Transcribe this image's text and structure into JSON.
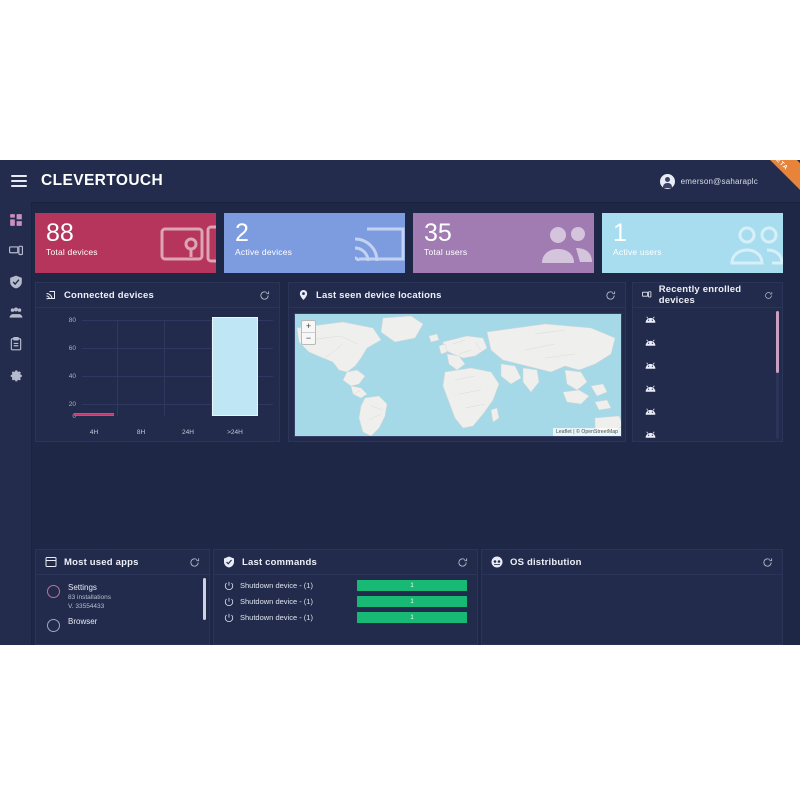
{
  "header": {
    "menu_icon": "hamburger-menu-icon",
    "brand": "CLEVERTOUCH",
    "user_email": "emerson@saharaplc",
    "avatar_icon": "user-avatar-icon",
    "beta_label": "BETA"
  },
  "sidebar": {
    "items": [
      {
        "icon": "dashboard-grid-icon",
        "name": "dashboard",
        "active": true
      },
      {
        "icon": "devices-icon",
        "name": "devices",
        "active": false
      },
      {
        "icon": "shield-icon",
        "name": "security",
        "active": false
      },
      {
        "icon": "users-icon",
        "name": "users",
        "active": false
      },
      {
        "icon": "clipboard-icon",
        "name": "reports",
        "active": false
      },
      {
        "icon": "gear-icon",
        "name": "settings",
        "active": false
      }
    ]
  },
  "stat_cards": [
    {
      "value": "88",
      "label": "Total devices",
      "color": "#b5355c",
      "icon": "device-screen-icon"
    },
    {
      "value": "2",
      "label": "Active devices",
      "color": "#7d9ce0",
      "icon": "cast-signal-icon"
    },
    {
      "value": "35",
      "label": "Total users",
      "color": "#a07cb2",
      "icon": "users-group-icon"
    },
    {
      "value": "1",
      "label": "Active users",
      "color": "#a8ddef",
      "icon": "users-group-icon"
    }
  ],
  "panels": {
    "connected_devices": {
      "title": "Connected devices",
      "icon": "cast-signal-icon",
      "refresh_icon": "refresh-icon"
    },
    "map": {
      "title": "Last seen device locations",
      "icon": "map-pin-icon",
      "refresh_icon": "refresh-icon",
      "zoom_in": "+",
      "zoom_out": "−",
      "attribution": "Leaflet | © OpenStreetMap"
    },
    "enrolled": {
      "title": "Recently enrolled devices",
      "icon": "devices-icon",
      "refresh_icon": "refresh-icon",
      "rows": [
        {
          "icon": "android-icon",
          "label": ""
        },
        {
          "icon": "android-icon",
          "label": ""
        },
        {
          "icon": "android-icon",
          "label": ""
        },
        {
          "icon": "android-icon",
          "label": ""
        },
        {
          "icon": "android-icon",
          "label": ""
        },
        {
          "icon": "android-icon",
          "label": ""
        }
      ]
    },
    "most_used_apps": {
      "title": "Most used apps",
      "icon": "apps-window-icon",
      "refresh_icon": "refresh-icon",
      "apps": [
        {
          "name": "Settings",
          "installations": "83 installations",
          "version": "V. 33554433",
          "icon": "settings-app-icon"
        },
        {
          "name": "Browser",
          "installations": "",
          "version": "",
          "icon": "browser-app-icon"
        }
      ]
    },
    "last_commands": {
      "title": "Last commands",
      "icon": "shield-check-icon",
      "refresh_icon": "refresh-icon",
      "bar_color": "#18b974",
      "rows": [
        {
          "icon": "power-icon",
          "label": "Shutdown device  - (1)",
          "count": "1"
        },
        {
          "icon": "power-icon",
          "label": "Shutdown device  - (1)",
          "count": "1"
        },
        {
          "icon": "power-icon",
          "label": "Shutdown device  - (1)",
          "count": "1"
        }
      ]
    },
    "os_distribution": {
      "title": "OS distribution",
      "icon": "os-chart-icon",
      "refresh_icon": "refresh-icon"
    }
  },
  "chart_data": {
    "type": "bar",
    "title": "Connected devices",
    "categories": [
      "4H",
      "8H",
      "24H",
      ">24H"
    ],
    "values": [
      1,
      0,
      0,
      86
    ],
    "xlabel": "",
    "ylabel": "",
    "ylim": [
      0,
      90
    ],
    "yticks": [
      0,
      20,
      40,
      60,
      80
    ],
    "grid": true,
    "legend": "none",
    "bar_colors": [
      "#c6356a",
      "#bfe6f4",
      "#bfe6f4",
      "#bfe6f4"
    ]
  }
}
